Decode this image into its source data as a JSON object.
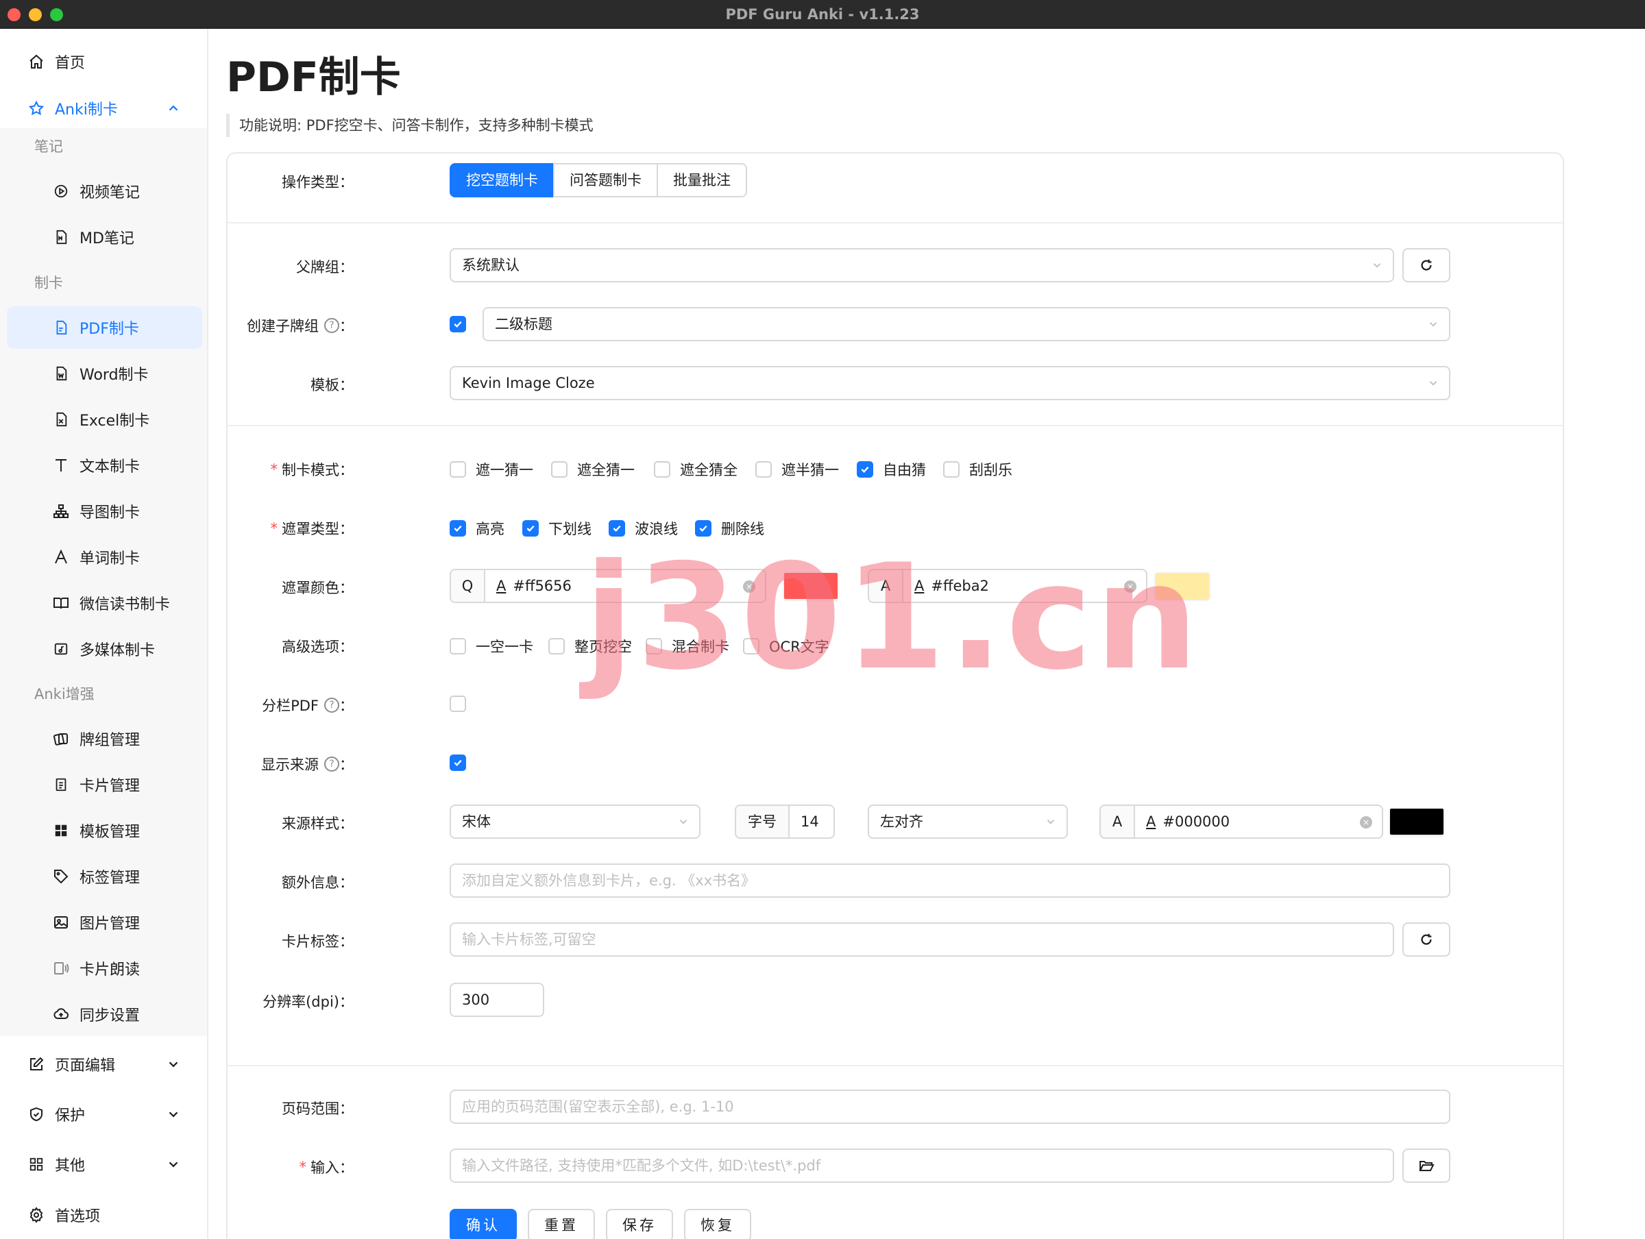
{
  "window": {
    "title": "PDF Guru Anki - v1.1.23"
  },
  "sidebar": {
    "home": "首页",
    "anki": "Anki制卡",
    "groups": {
      "notes": "笔记",
      "cards": "制卡",
      "enhance": "Anki增强"
    },
    "notes_items": [
      "视频笔记",
      "MD笔记"
    ],
    "card_items": [
      "PDF制卡",
      "Word制卡",
      "Excel制卡",
      "文本制卡",
      "导图制卡",
      "单词制卡",
      "微信读书制卡",
      "多媒体制卡"
    ],
    "enhance_items": [
      "牌组管理",
      "卡片管理",
      "模板管理",
      "标签管理",
      "图片管理",
      "卡片朗读",
      "同步设置"
    ],
    "bottom_items": [
      "页面编辑",
      "保护",
      "其他",
      "首选项"
    ]
  },
  "page": {
    "title": "PDF制卡",
    "description": "功能说明: PDF挖空卡、问答卡制作，支持多种制卡模式"
  },
  "form": {
    "op_type": {
      "label": "操作类型：",
      "options": [
        "挖空题制卡",
        "问答题制卡",
        "批量批注"
      ],
      "selected": "挖空题制卡"
    },
    "parent_deck": {
      "label": "父牌组：",
      "value": "系统默认"
    },
    "child_deck": {
      "label": "创建子牌组",
      "suffix": "：",
      "checked": true,
      "value": "二级标题"
    },
    "template": {
      "label": "模板：",
      "value": "Kevin Image Cloze"
    },
    "mode": {
      "label": "制卡模式：",
      "options": [
        {
          "text": "遮一猜一",
          "checked": false
        },
        {
          "text": "遮全猜一",
          "checked": false
        },
        {
          "text": "遮全猜全",
          "checked": false
        },
        {
          "text": "遮半猜一",
          "checked": false
        },
        {
          "text": "自由猜",
          "checked": true
        },
        {
          "text": "刮刮乐",
          "checked": false
        }
      ]
    },
    "mask_type": {
      "label": "遮罩类型：",
      "options": [
        {
          "text": "高亮",
          "checked": true
        },
        {
          "text": "下划线",
          "checked": true
        },
        {
          "text": "波浪线",
          "checked": true
        },
        {
          "text": "删除线",
          "checked": true
        }
      ]
    },
    "mask_color": {
      "label": "遮罩颜色：",
      "q": {
        "prefix": "Q",
        "a_glyph": "A",
        "value": "#ff5656",
        "swatch": "#ff5656"
      },
      "a": {
        "prefix": "A",
        "a_glyph": "A",
        "value": "#ffeba2",
        "swatch": "#ffeba2"
      }
    },
    "advanced": {
      "label": "高级选项：",
      "options": [
        {
          "text": "一空一卡",
          "checked": false
        },
        {
          "text": "整页挖空",
          "checked": false
        },
        {
          "text": "混合制卡",
          "checked": false
        },
        {
          "text": "OCR文字",
          "checked": false
        }
      ]
    },
    "columns_pdf": {
      "label": "分栏PDF",
      "suffix": "：",
      "checked": false
    },
    "show_source": {
      "label": "显示来源",
      "suffix": "：",
      "checked": true
    },
    "source_style": {
      "label": "来源样式：",
      "font": "宋体",
      "size_label": "字号",
      "size": "14",
      "align": "左对齐",
      "color_prefix": "A",
      "color_glyph": "A",
      "color": "#000000",
      "swatch": "#000000"
    },
    "extra": {
      "label": "额外信息：",
      "placeholder": "添加自定义额外信息到卡片，e.g. 《xx书名》"
    },
    "tags": {
      "label": "卡片标签：",
      "placeholder": "输入卡片标签,可留空"
    },
    "dpi": {
      "label": "分辨率(dpi)：",
      "value": "300"
    },
    "page_range": {
      "label": "页码范围：",
      "placeholder": "应用的页码范围(留空表示全部), e.g. 1-10"
    },
    "input": {
      "label": "输入：",
      "placeholder": "输入文件路径, 支持使用*匹配多个文件, 如D:\\test\\*.pdf"
    },
    "buttons": {
      "confirm": "确认",
      "reset": "重置",
      "save": "保存",
      "restore": "恢复"
    }
  },
  "watermark": "j301.cn",
  "colors": {
    "accent": "#1677ff",
    "required": "#ff4d4f"
  }
}
